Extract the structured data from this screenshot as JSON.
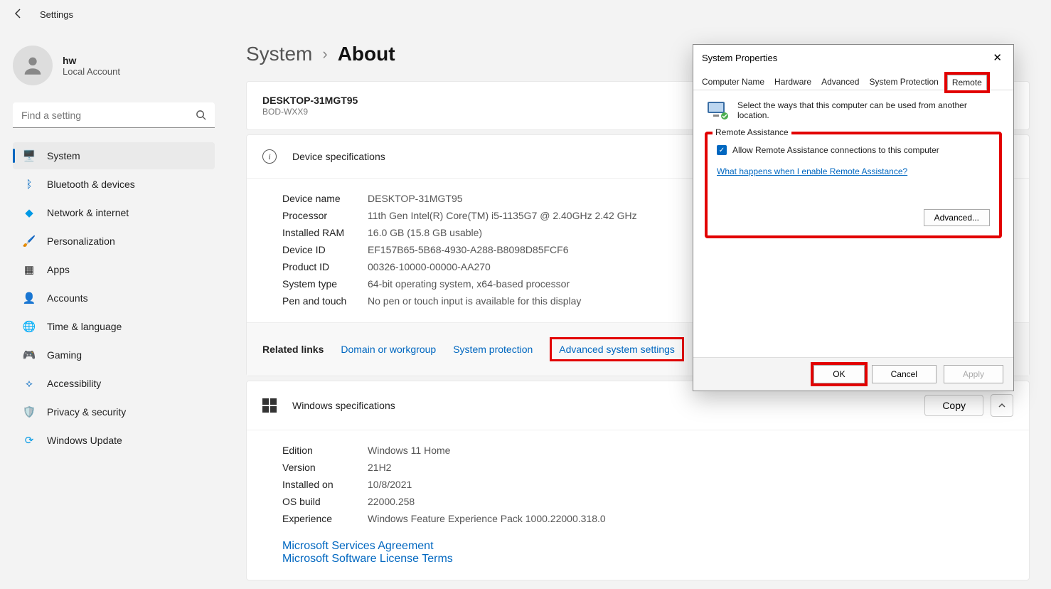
{
  "app": {
    "title": "Settings"
  },
  "profile": {
    "name": "hw",
    "sub": "Local Account"
  },
  "search": {
    "placeholder": "Find a setting"
  },
  "nav": {
    "items": [
      {
        "label": "System"
      },
      {
        "label": "Bluetooth & devices"
      },
      {
        "label": "Network & internet"
      },
      {
        "label": "Personalization"
      },
      {
        "label": "Apps"
      },
      {
        "label": "Accounts"
      },
      {
        "label": "Time & language"
      },
      {
        "label": "Gaming"
      },
      {
        "label": "Accessibility"
      },
      {
        "label": "Privacy & security"
      },
      {
        "label": "Windows Update"
      }
    ]
  },
  "breadcrumb": {
    "parent": "System",
    "current": "About"
  },
  "device_card": {
    "name": "DESKTOP-31MGT95",
    "model": "BOD-WXX9"
  },
  "device_specs": {
    "title": "Device specifications",
    "rows": {
      "device_name": {
        "k": "Device name",
        "v": "DESKTOP-31MGT95"
      },
      "processor": {
        "k": "Processor",
        "v": "11th Gen Intel(R) Core(TM) i5-1135G7 @ 2.40GHz   2.42 GHz"
      },
      "ram": {
        "k": "Installed RAM",
        "v": "16.0 GB (15.8 GB usable)"
      },
      "device_id": {
        "k": "Device ID",
        "v": "EF157B65-5B68-4930-A288-B8098D85FCF6"
      },
      "product_id": {
        "k": "Product ID",
        "v": "00326-10000-00000-AA270"
      },
      "system_type": {
        "k": "System type",
        "v": "64-bit operating system, x64-based processor"
      },
      "pen_touch": {
        "k": "Pen and touch",
        "v": "No pen or touch input is available for this display"
      }
    }
  },
  "related": {
    "label": "Related links",
    "domain": "Domain or workgroup",
    "protection": "System protection",
    "advanced": "Advanced system settings"
  },
  "win_specs": {
    "title": "Windows specifications",
    "copy": "Copy",
    "rows": {
      "edition": {
        "k": "Edition",
        "v": "Windows 11 Home"
      },
      "version": {
        "k": "Version",
        "v": "21H2"
      },
      "installed": {
        "k": "Installed on",
        "v": "10/8/2021"
      },
      "build": {
        "k": "OS build",
        "v": "22000.258"
      },
      "experience": {
        "k": "Experience",
        "v": "Windows Feature Experience Pack 1000.22000.318.0"
      }
    },
    "links": {
      "msa": "Microsoft Services Agreement",
      "mslt": "Microsoft Software License Terms"
    }
  },
  "dialog": {
    "title": "System Properties",
    "tabs": {
      "comp": "Computer Name",
      "hw": "Hardware",
      "adv": "Advanced",
      "prot": "System Protection",
      "remote": "Remote"
    },
    "desc": "Select the ways that this computer can be used from another location.",
    "group": "Remote Assistance",
    "cb": "Allow Remote Assistance connections to this computer",
    "help": "What happens when I enable Remote Assistance?",
    "advanced_btn": "Advanced...",
    "ok": "OK",
    "cancel": "Cancel",
    "apply": "Apply"
  }
}
